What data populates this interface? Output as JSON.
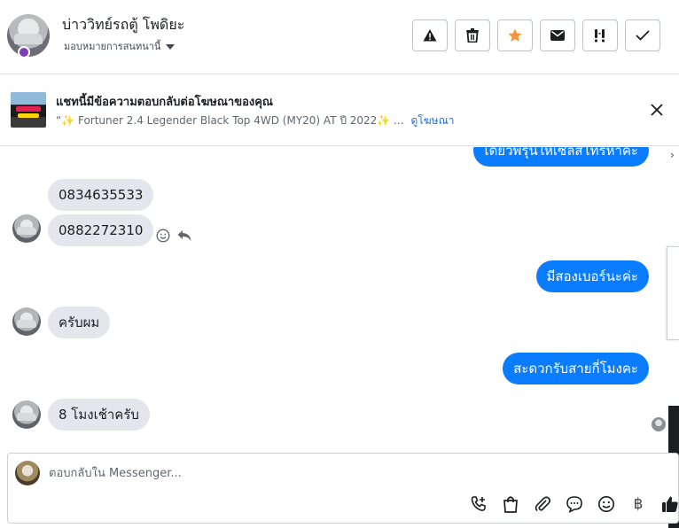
{
  "header": {
    "contact_name": "บ่าววิทย์รถตู้ โพดิยะ",
    "assign_label": "มอบหมายการสนทนานี้",
    "actions": [
      "report-icon",
      "trash-icon",
      "star-icon",
      "envelope-icon",
      "important-icon",
      "check-icon"
    ]
  },
  "ad_banner": {
    "title": "แชทนี้มีข้อความตอบกลับต่อโฆษณาของคุณ",
    "subtitle": "“✨ Fortuner 2.4 Legender Black Top 4WD (MY20) AT ปี 2022✨ ...",
    "link": "ดูโฆษณา"
  },
  "messages": [
    {
      "side": "out",
      "text": "เดี๋ยวพี่รุ่นให้เซลส์โทรหาค่ะ"
    },
    {
      "side": "in",
      "text": "0834635533"
    },
    {
      "side": "in",
      "text": "0882272310"
    },
    {
      "side": "out",
      "text": "มีสองเบอร์นะค่ะ"
    },
    {
      "side": "in",
      "text": "ครับผม"
    },
    {
      "side": "out",
      "text": "สะดวกรับสายกี่โมงคะ"
    },
    {
      "side": "in",
      "text": "8 โมงเช้าครับ"
    }
  ],
  "composer": {
    "placeholder": "ตอบกลับใน Messenger...",
    "currency_symbol": "฿"
  },
  "colors": {
    "accent": "#0a7cff",
    "incoming_bubble": "#e4e6eb",
    "star": "#f7923b",
    "link": "#216fdb"
  }
}
